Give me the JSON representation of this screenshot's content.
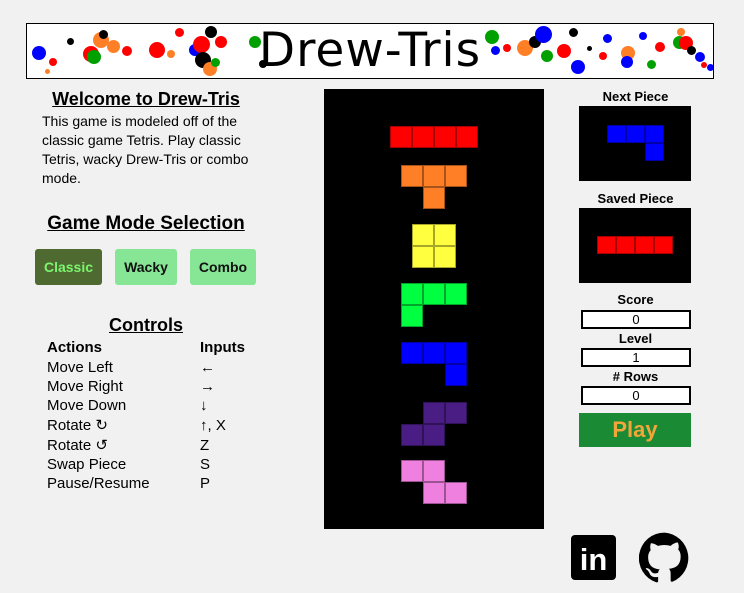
{
  "header": {
    "title": "Drew-Tris"
  },
  "intro": {
    "title": "Welcome to Drew-Tris",
    "text": "This game is modeled off of the classic game Tetris. Play classic Tetris, wacky Drew-Tris or combo mode."
  },
  "modes": {
    "title": "Game Mode Selection",
    "classic": "Classic",
    "wacky": "Wacky",
    "combo": "Combo",
    "selected": "Classic"
  },
  "controls": {
    "title": "Controls",
    "actions_header": "Actions",
    "inputs_header": "Inputs",
    "rows": [
      {
        "action": "Move Left",
        "input": "←"
      },
      {
        "action": "Move Right",
        "input": "→"
      },
      {
        "action": "Move Down",
        "input": "↓"
      },
      {
        "action": "Rotate ↻",
        "input": "↑, X"
      },
      {
        "action": "Rotate ↺",
        "input": "Z"
      },
      {
        "action": "Swap Piece",
        "input": "S"
      },
      {
        "action": "Pause/Resume",
        "input": "P"
      }
    ]
  },
  "side": {
    "next_label": "Next Piece",
    "saved_label": "Saved Piece",
    "score_label": "Score",
    "score": "0",
    "level_label": "Level",
    "level": "1",
    "rows_label": "# Rows",
    "rows": "0",
    "play_label": "Play"
  },
  "links": {
    "linkedin": "in"
  },
  "colors": {
    "red": "#ff0000",
    "orange": "#ff7f27",
    "yellow": "#ffff40",
    "green": "#00ff40",
    "blue": "#0000ff",
    "purple": "#4a1d85",
    "pink": "#f080e0"
  }
}
